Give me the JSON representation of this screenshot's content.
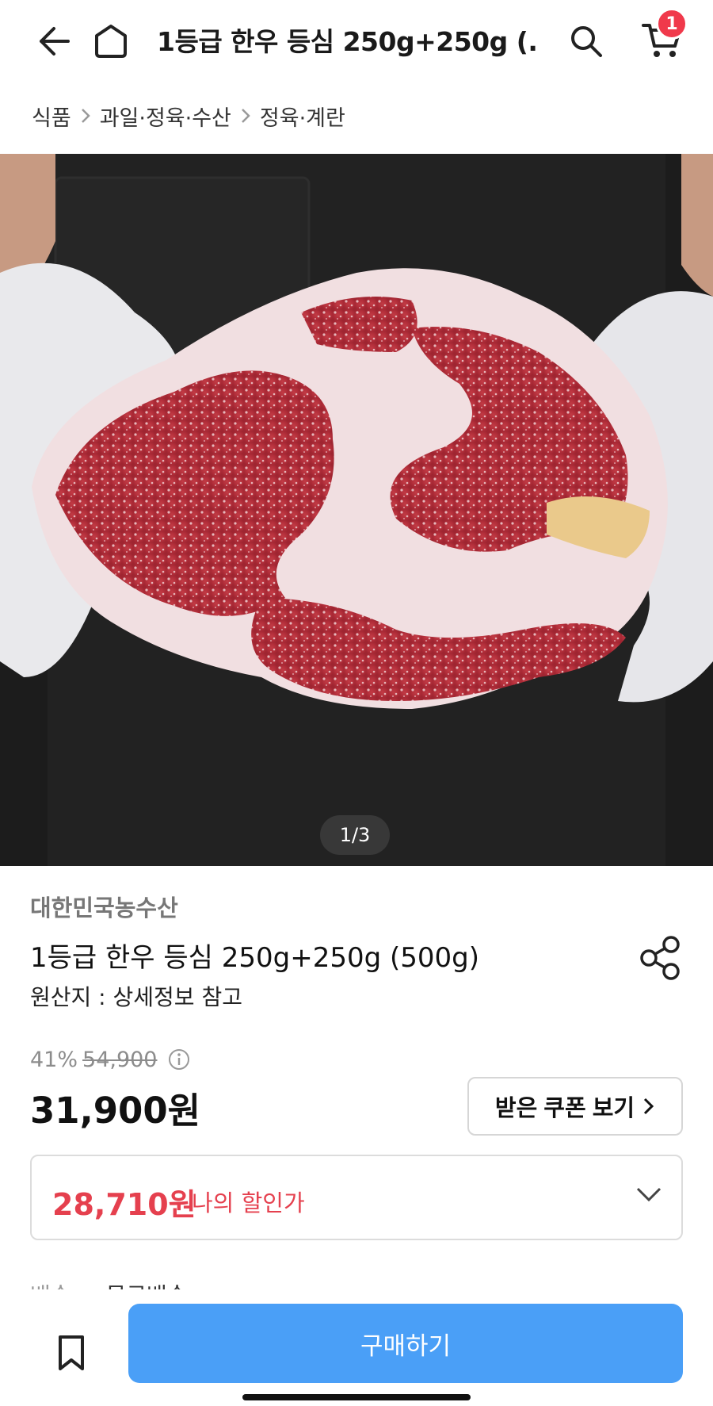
{
  "header": {
    "title": "1등급 한우 등심 250g+250g (...",
    "cart_badge": "1"
  },
  "breadcrumb": [
    "식품",
    "과일·정육·수산",
    "정육·계란"
  ],
  "hero": {
    "image_alt": "",
    "page_indicator": "1/3"
  },
  "product": {
    "seller": "대한민국농수산",
    "name": "1등급 한우 등심 250g+250g (500g)",
    "origin": "원산지 : 상세정보 참고",
    "discount_rate": "41%",
    "original_price": "54,900",
    "price": "31,900원"
  },
  "coupon": {
    "label": "받은 쿠폰 보기"
  },
  "my_price": {
    "value": "28,710원",
    "label": "나의 할인가"
  },
  "delivery": {
    "label": "배송",
    "value": "무료배송"
  },
  "bottom": {
    "buy_label": "구매하기"
  },
  "colors": {
    "accent_blue": "#4a9ff7",
    "discount_red": "#e5404e",
    "badge_red": "#f0394b"
  }
}
